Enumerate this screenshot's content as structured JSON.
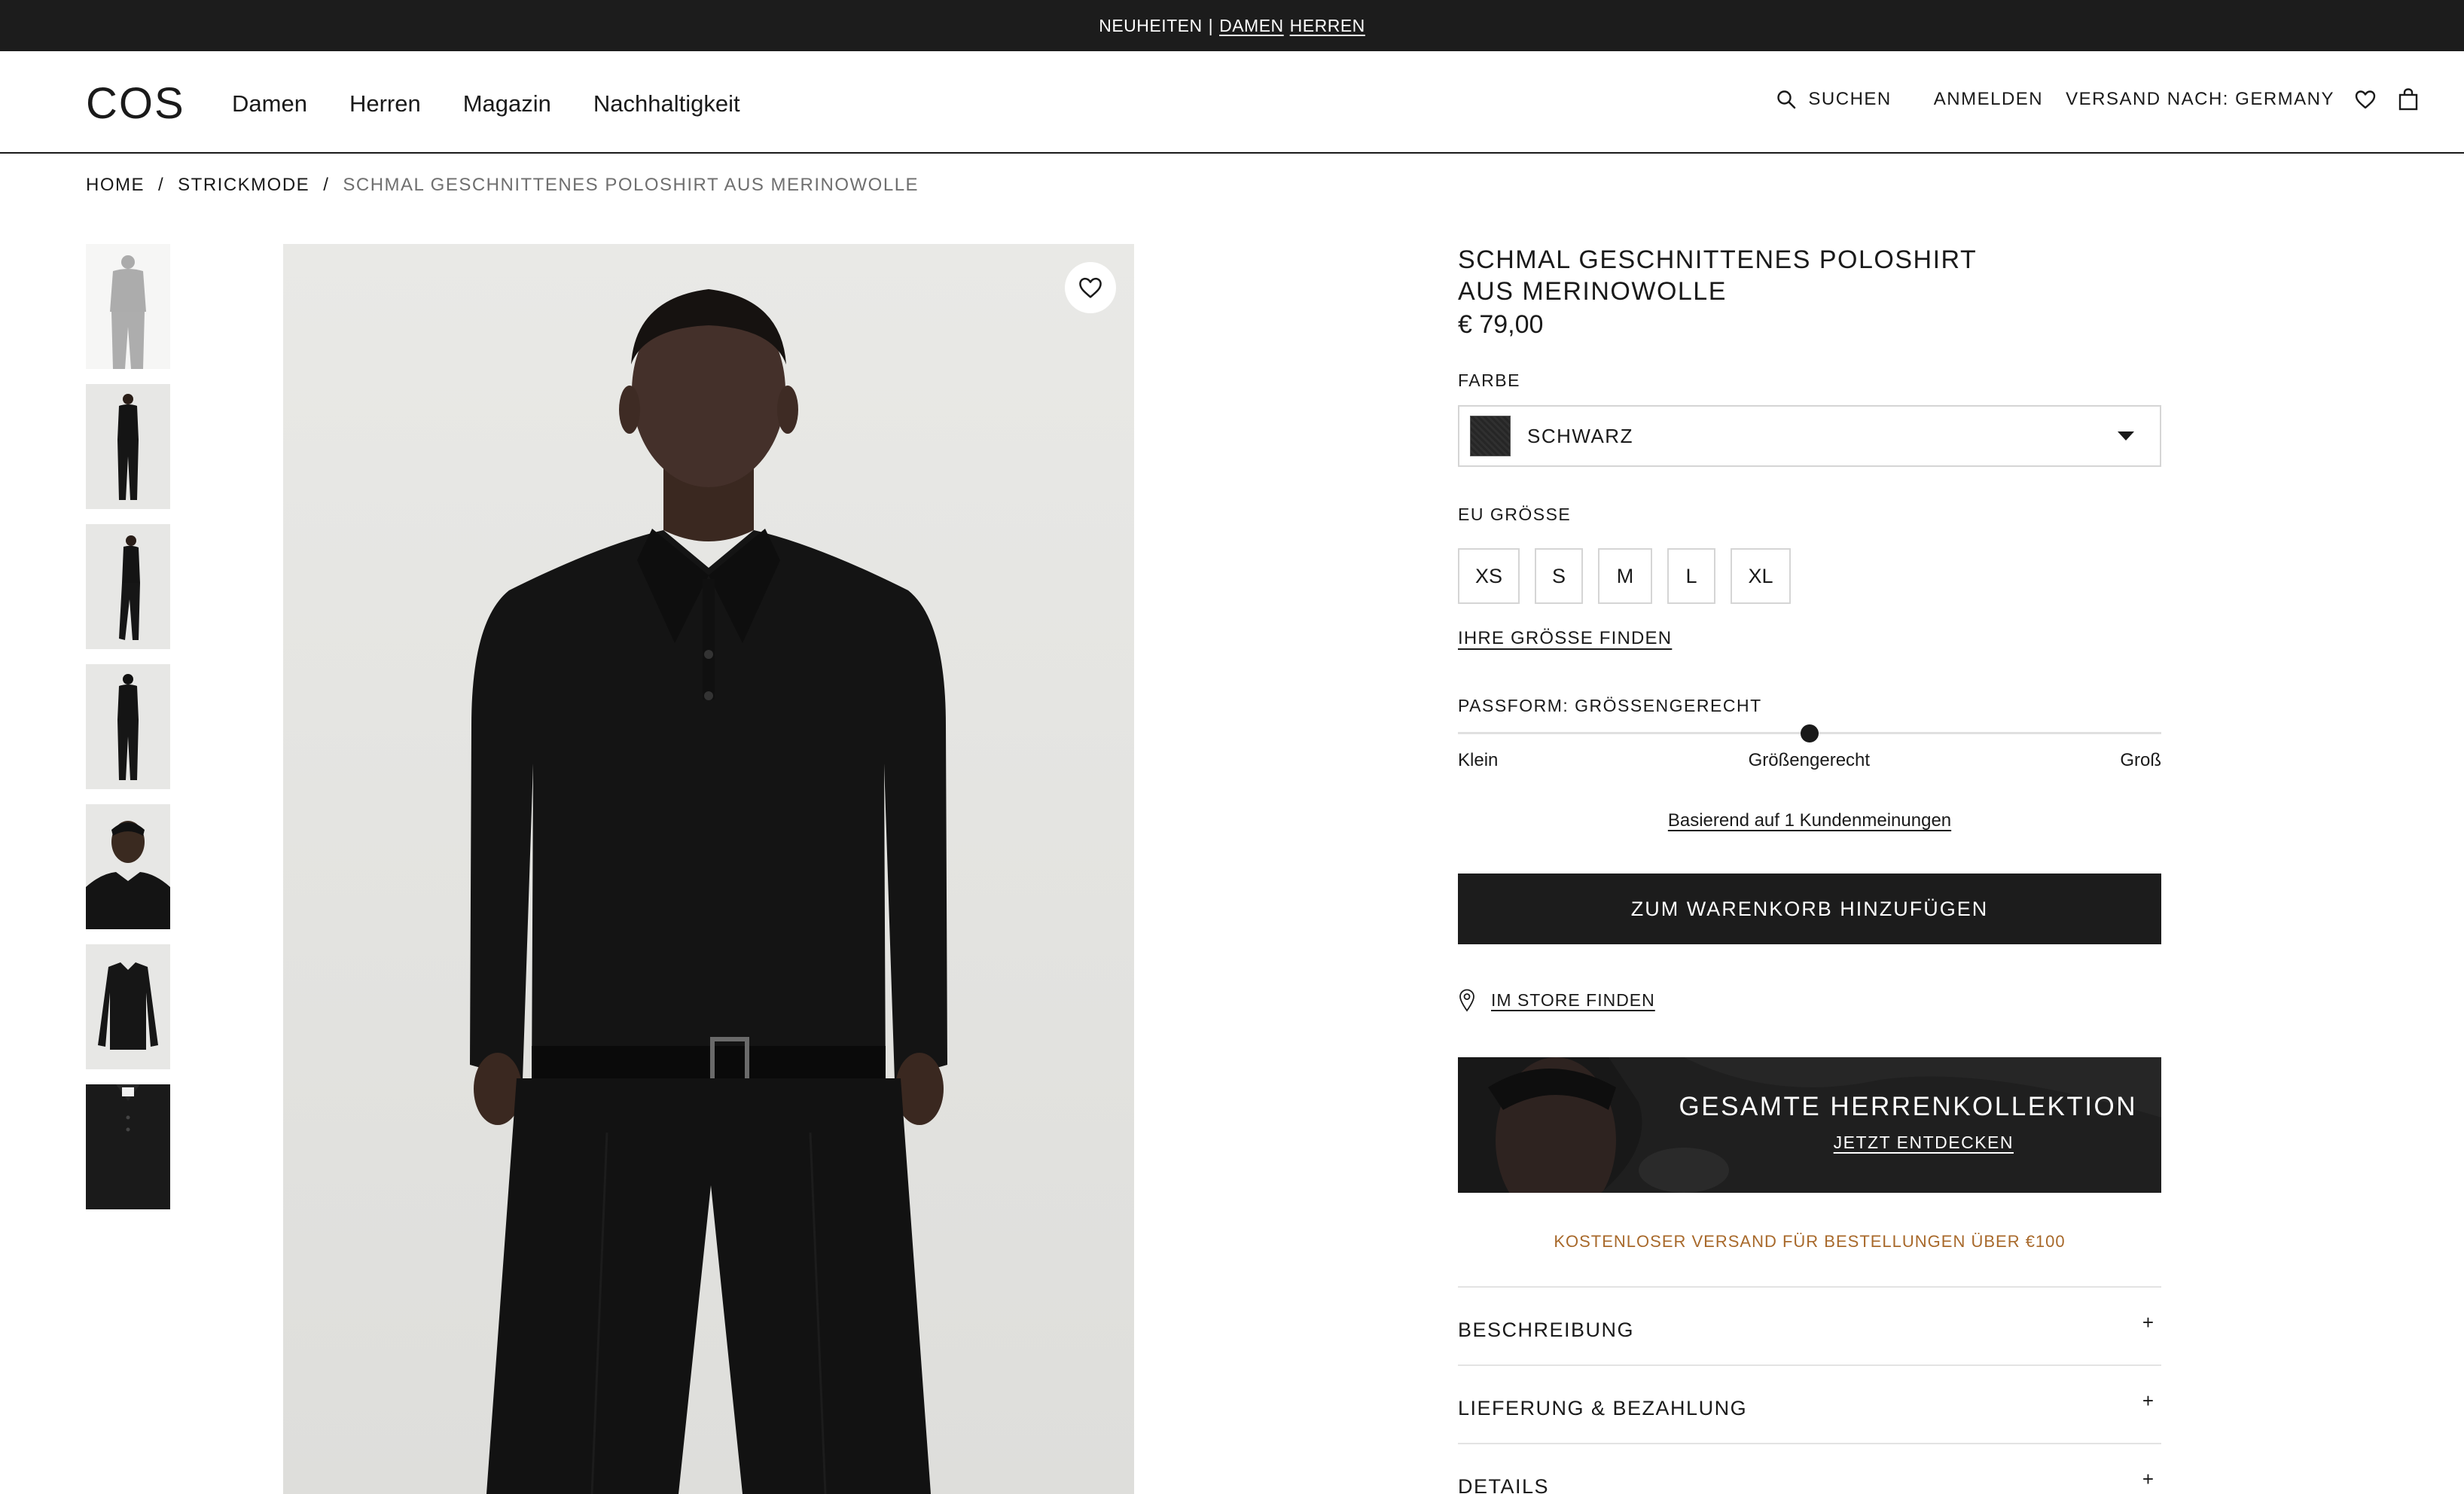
{
  "topbar": {
    "text": "NEUHEITEN",
    "separator": "|",
    "links": [
      "DAMEN",
      "HERREN"
    ]
  },
  "header": {
    "logo": "COS",
    "nav": [
      "Damen",
      "Herren",
      "Magazin",
      "Nachhaltigkeit"
    ],
    "search_label": "SUCHEN",
    "login_label": "ANMELDEN",
    "shipping_label": "VERSAND NACH: GERMANY",
    "icons": [
      "search-icon",
      "heart-icon",
      "bag-icon"
    ]
  },
  "breadcrumb": {
    "items": [
      "HOME",
      "STRICKMODE"
    ],
    "divider": "/",
    "current": "SCHMAL GESCHNITTENES POLOSHIRT AUS MERINOWOLLE"
  },
  "gallery": {
    "thumbnail_count": 7,
    "wishlist_icon": "heart-icon"
  },
  "product": {
    "title_line1": "SCHMAL GESCHNITTENES POLOSHIRT",
    "title_line2": "AUS MERINOWOLLE",
    "price": "€ 79,00",
    "color_label": "FARBE",
    "color_value": "SCHWARZ",
    "color_swatch": "#2b2b2b",
    "size_label": "EU GRÖSSE",
    "sizes": [
      "XS",
      "S",
      "M",
      "L",
      "XL"
    ],
    "find_size": "IHRE GRÖSSE FINDEN",
    "fit_label": "PASSFORM: GRÖSSENGERECHT",
    "fit_position": 0.5,
    "fit_scale": [
      "Klein",
      "Größengerecht",
      "Groß"
    ],
    "reviews": "Basierend auf 1 Kundenmeinungen",
    "add_to_cart": "ZUM WARENKORB HINZUFÜGEN",
    "store_finder": "IM STORE FINDEN",
    "banner_title": "GESAMTE HERRENKOLLEKTION",
    "banner_link": "JETZT ENTDECKEN",
    "shipping_note": "KOSTENLOSER VERSAND FÜR BESTELLUNGEN ÜBER €100",
    "accordion": [
      "BESCHREIBUNG",
      "LIEFERUNG & BEZAHLUNG",
      "DETAILS"
    ],
    "accordion_icon": "+"
  },
  "colors": {
    "topbar_bg": "#1c1c1c",
    "button_bg": "#1c1c1c",
    "accent_note": "#a8692b",
    "image_bg": "#e6e6e3"
  }
}
